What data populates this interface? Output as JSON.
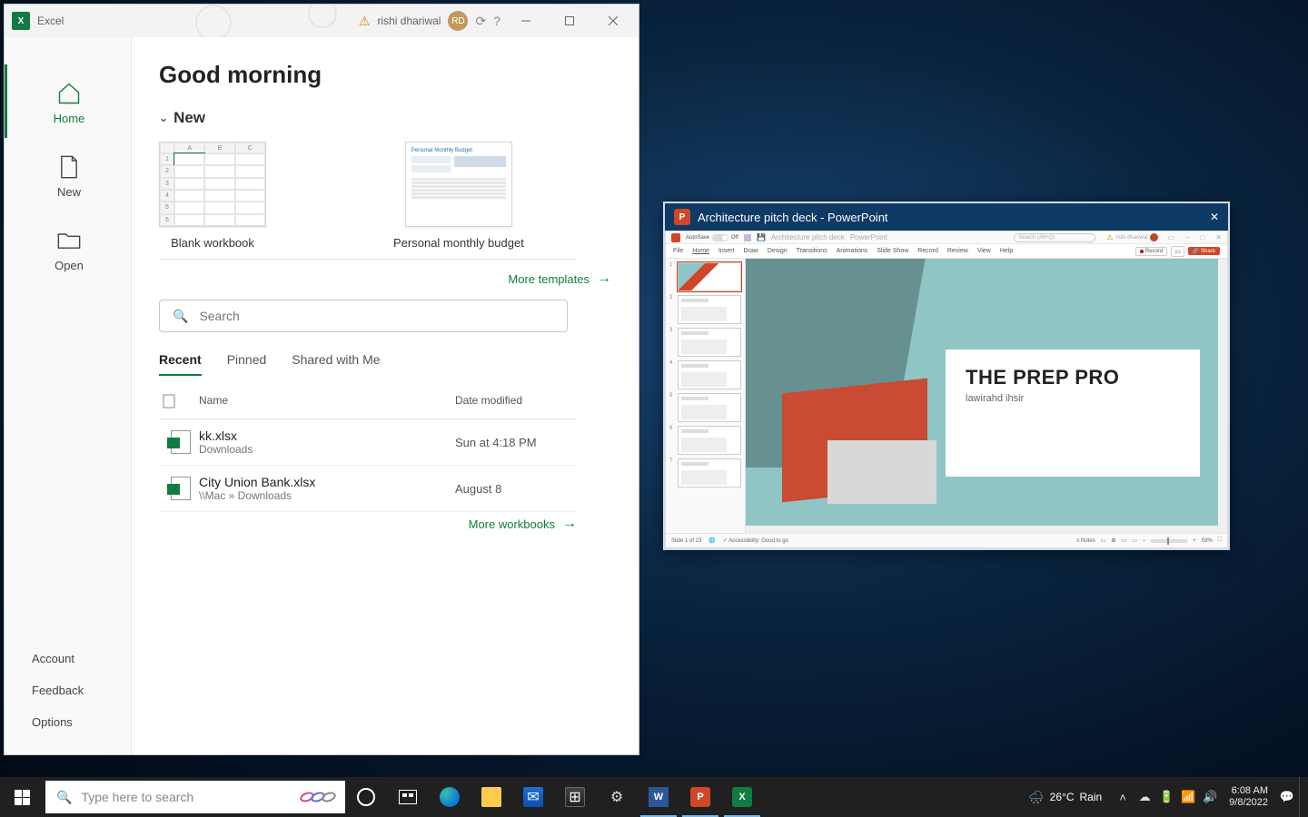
{
  "excel": {
    "app_title": "Excel",
    "user": "rishi dhariwal",
    "user_initials": "RD",
    "sidebar": {
      "home": "Home",
      "new": "New",
      "open": "Open",
      "account": "Account",
      "feedback": "Feedback",
      "options": "Options"
    },
    "greeting": "Good morning",
    "section_new": "New",
    "templates": {
      "blank": "Blank workbook",
      "budget": "Personal monthly budget",
      "budget_thumb_title": "Personal Monthly Budget"
    },
    "more_templates": "More templates",
    "search_placeholder": "Search",
    "file_tabs": {
      "recent": "Recent",
      "pinned": "Pinned",
      "shared": "Shared with Me"
    },
    "table_headers": {
      "name": "Name",
      "date": "Date modified"
    },
    "files": [
      {
        "name": "kk.xlsx",
        "path": "Downloads",
        "date": "Sun at 4:18 PM"
      },
      {
        "name": "City Union Bank.xlsx",
        "path": "\\\\Mac » Downloads",
        "date": "August 8"
      }
    ],
    "more_workbooks": "More workbooks"
  },
  "ppt_preview": {
    "window_title": "Architecture pitch deck - PowerPoint",
    "autosave_label": "AutoSave",
    "autosave_state": "Off",
    "doc_title_bar": "Architecture pitch deck",
    "app_name_bar": "PowerPoint",
    "search_placeholder": "Search (Alt+Q)",
    "user": "rishi dhariwal",
    "ribbon": [
      "File",
      "Home",
      "Insert",
      "Draw",
      "Design",
      "Transitions",
      "Animations",
      "Slide Show",
      "Record",
      "Review",
      "View",
      "Help"
    ],
    "record_btn": "Record",
    "share_btn": "Share",
    "slide_title": "THE PREP PRO",
    "slide_sub": "lawirahd ihsir",
    "status_slide": "Slide 1 of 23",
    "status_access": "Accessibility: Good to go",
    "notes": "Notes",
    "zoom": "59%",
    "thumb_count": 7
  },
  "taskbar": {
    "search_placeholder": "Type here to search",
    "weather_temp": "26°C",
    "weather_cond": "Rain",
    "time": "6:08 AM",
    "date": "9/8/2022"
  }
}
